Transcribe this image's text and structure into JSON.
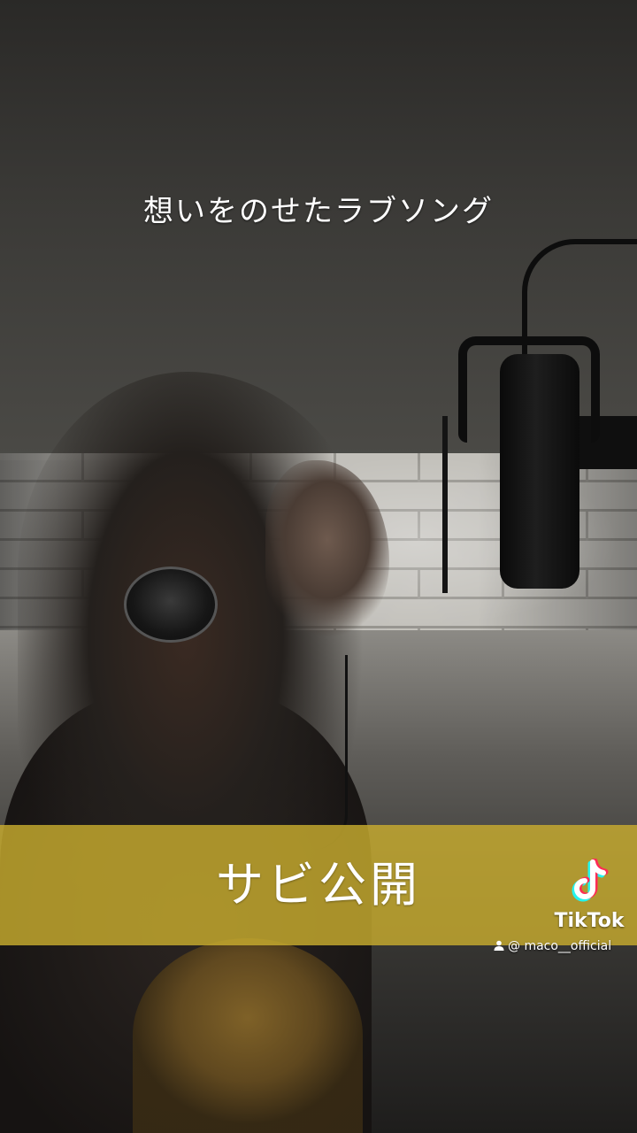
{
  "overlay": {
    "top_caption": "想いをのせたラブソング",
    "banner_text": "サビ公開",
    "banner_color": "#c8ac2e"
  },
  "watermark": {
    "brand": "TikTok",
    "logo_icon": "tiktok-note-icon",
    "user_icon": "person-icon",
    "username": "@ maco__official"
  }
}
